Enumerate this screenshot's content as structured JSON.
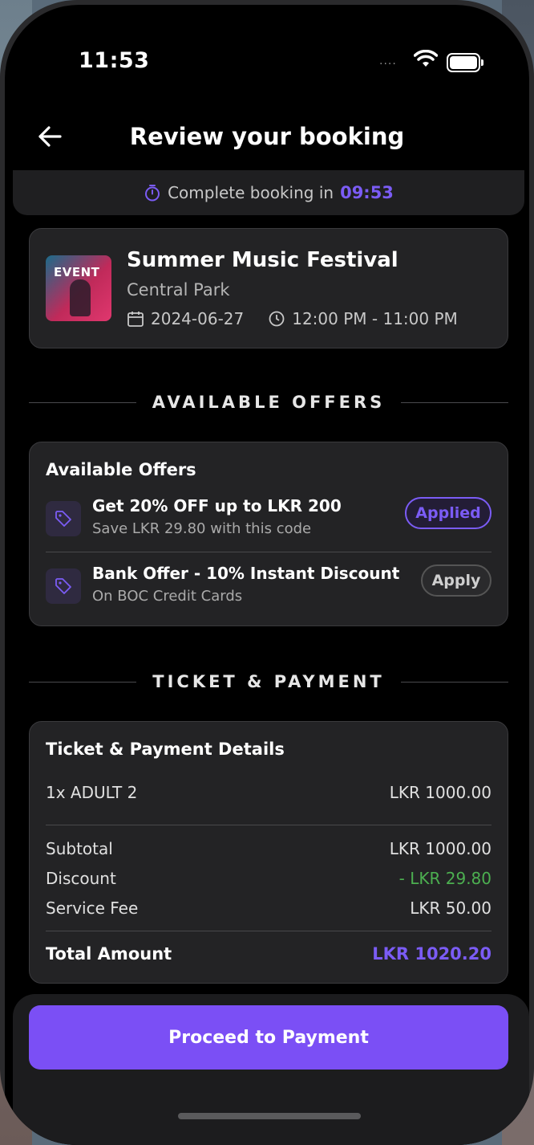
{
  "status_bar": {
    "time": "11:53",
    "signal": "....",
    "wifi_icon": "wifi-icon",
    "battery_icon": "battery-icon"
  },
  "header": {
    "title": "Review your booking",
    "back_icon": "arrow-left-icon"
  },
  "timer": {
    "label": "Complete booking in",
    "countdown": "09:53",
    "icon": "stopwatch-icon"
  },
  "event": {
    "poster_text": "EVENT",
    "name": "Summer Music Festival",
    "venue": "Central Park",
    "date": "2024-06-27",
    "time": "12:00 PM - 11:00 PM",
    "date_icon": "calendar-icon",
    "time_icon": "clock-icon"
  },
  "offers_section": {
    "divider": "AVAILABLE OFFERS",
    "title": "Available Offers",
    "items": [
      {
        "title": "Get 20% OFF up to LKR 200",
        "subtitle": "Save LKR 29.80 with this code",
        "action": "Applied",
        "icon": "tag-icon"
      },
      {
        "title": "Bank Offer - 10% Instant Discount",
        "subtitle": "On BOC Credit Cards",
        "action": "Apply",
        "icon": "tag-icon"
      }
    ]
  },
  "payment_section": {
    "divider": "TICKET & PAYMENT",
    "title": "Ticket & Payment Details",
    "ticket": {
      "label": "1x ADULT 2",
      "amount": "LKR 1000.00"
    },
    "subtotal": {
      "label": "Subtotal",
      "amount": "LKR 1000.00"
    },
    "discount": {
      "label": "Discount",
      "amount": "- LKR 29.80"
    },
    "service_fee": {
      "label": "Service Fee",
      "amount": "LKR 50.00"
    },
    "total": {
      "label": "Total Amount",
      "amount": "LKR 1020.20"
    }
  },
  "footer": {
    "proceed_label": "Proceed to Payment"
  },
  "colors": {
    "accent": "#7b5cf5",
    "discount_green": "#4caf50",
    "background": "#000000",
    "card": "#232325"
  }
}
